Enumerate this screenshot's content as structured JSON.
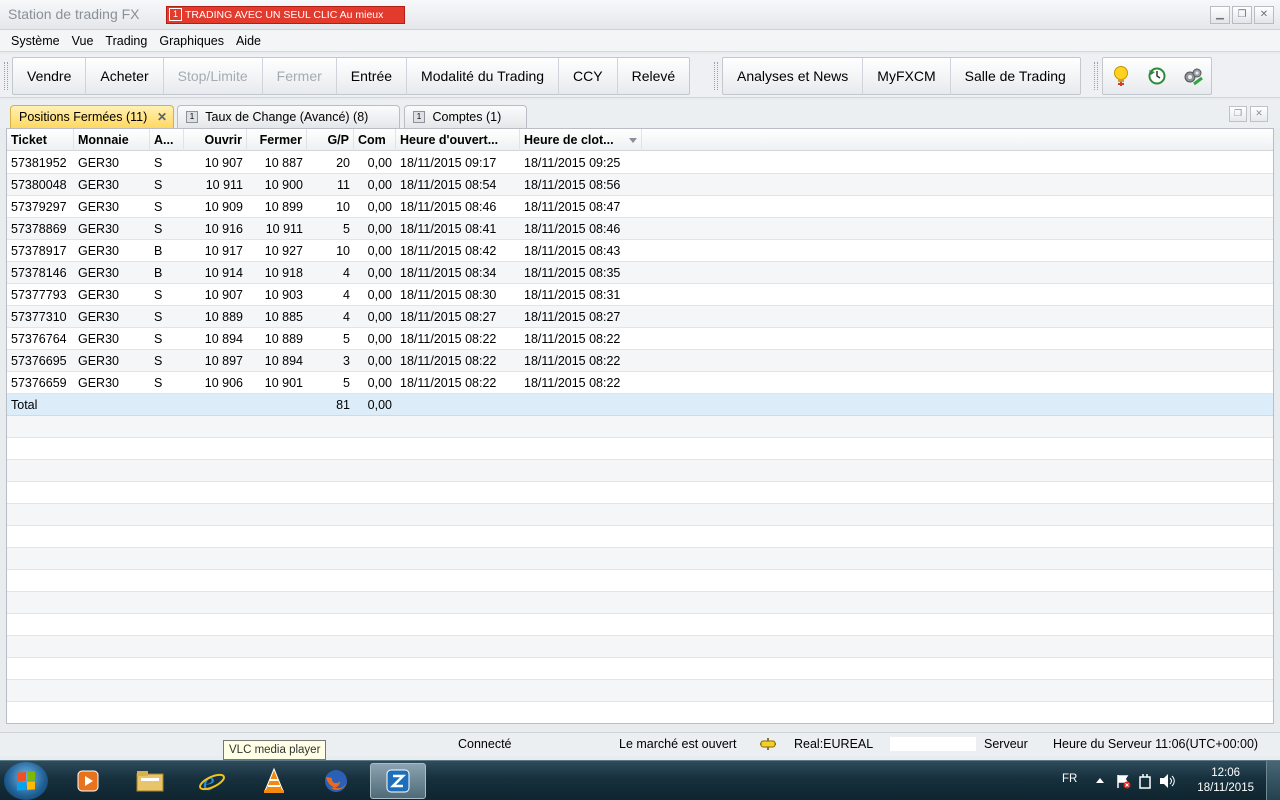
{
  "window": {
    "title": "Station de trading FX",
    "one_click_label": "TRADING AVEC UN SEUL CLIC Au mieux",
    "one_click_icon_text": "1",
    "btn_minimize": "▁",
    "btn_restore": "❐",
    "btn_close": "✕"
  },
  "menu": [
    "Système",
    "Vue",
    "Trading",
    "Graphiques",
    "Aide"
  ],
  "toolbar": {
    "group1": [
      {
        "label": "Vendre",
        "enabled": true
      },
      {
        "label": "Acheter",
        "enabled": true
      },
      {
        "label": "Stop/Limite",
        "enabled": false
      },
      {
        "label": "Fermer",
        "enabled": false
      },
      {
        "label": "Entrée",
        "enabled": true
      },
      {
        "label": "Modalité du Trading",
        "enabled": true
      },
      {
        "label": "CCY",
        "enabled": true
      },
      {
        "label": "Relevé",
        "enabled": true
      }
    ],
    "group2": [
      {
        "label": "Analyses et News"
      },
      {
        "label": "MyFXCM"
      },
      {
        "label": "Salle de Trading"
      }
    ],
    "icons": [
      "alert-bulb-icon",
      "refresh-clock-icon",
      "settings-gears-icon"
    ]
  },
  "tabs": [
    {
      "label": "Positions Fermées (11)",
      "active": true,
      "close": "✕"
    },
    {
      "label": "Taux de Change (Avancé) (8)",
      "active": false,
      "glyph": "1"
    },
    {
      "label": "Comptes (1)",
      "active": false,
      "glyph": "1"
    }
  ],
  "panel_buttons": {
    "restore": "❐",
    "close": "✕"
  },
  "grid": {
    "columns": [
      "Ticket",
      "Monnaie",
      "A...",
      "Ouvrir",
      "Fermer",
      "G/P",
      "Com",
      "Heure d'ouvert...",
      "Heure de clot..."
    ],
    "rows": [
      [
        "57381952",
        "GER30",
        "S",
        "10 907",
        "10 887",
        "20",
        "0,00",
        "18/11/2015 09:17",
        "18/11/2015 09:25"
      ],
      [
        "57380048",
        "GER30",
        "S",
        "10 911",
        "10 900",
        "11",
        "0,00",
        "18/11/2015 08:54",
        "18/11/2015 08:56"
      ],
      [
        "57379297",
        "GER30",
        "S",
        "10 909",
        "10 899",
        "10",
        "0,00",
        "18/11/2015 08:46",
        "18/11/2015 08:47"
      ],
      [
        "57378869",
        "GER30",
        "S",
        "10 916",
        "10 911",
        "5",
        "0,00",
        "18/11/2015 08:41",
        "18/11/2015 08:46"
      ],
      [
        "57378917",
        "GER30",
        "B",
        "10 917",
        "10 927",
        "10",
        "0,00",
        "18/11/2015 08:42",
        "18/11/2015 08:43"
      ],
      [
        "57378146",
        "GER30",
        "B",
        "10 914",
        "10 918",
        "4",
        "0,00",
        "18/11/2015 08:34",
        "18/11/2015 08:35"
      ],
      [
        "57377793",
        "GER30",
        "S",
        "10 907",
        "10 903",
        "4",
        "0,00",
        "18/11/2015 08:30",
        "18/11/2015 08:31"
      ],
      [
        "57377310",
        "GER30",
        "S",
        "10 889",
        "10 885",
        "4",
        "0,00",
        "18/11/2015 08:27",
        "18/11/2015 08:27"
      ],
      [
        "57376764",
        "GER30",
        "S",
        "10 894",
        "10 889",
        "5",
        "0,00",
        "18/11/2015 08:22",
        "18/11/2015 08:22"
      ],
      [
        "57376695",
        "GER30",
        "S",
        "10 897",
        "10 894",
        "3",
        "0,00",
        "18/11/2015 08:22",
        "18/11/2015 08:22"
      ],
      [
        "57376659",
        "GER30",
        "S",
        "10 906",
        "10 901",
        "5",
        "0,00",
        "18/11/2015 08:22",
        "18/11/2015 08:22"
      ]
    ],
    "total": {
      "label": "Total",
      "gp": "81",
      "com": "0,00"
    }
  },
  "statusbar": {
    "connection": "Connecté",
    "market": "Le marché est ouvert",
    "account": "Real:EUREAL",
    "server": "Serveur",
    "server_time": "Heure du Serveur 11:06(UTC+00:00)"
  },
  "tooltip": "VLC media player",
  "taskbar": {
    "apps": [
      "windows-media-player-icon",
      "file-explorer-icon",
      "internet-explorer-icon",
      "vlc-icon",
      "firefox-icon",
      "fxcm-trading-station-icon"
    ],
    "language": "FR",
    "time": "12:06",
    "date": "18/11/2015"
  },
  "colors": {
    "active_tab": "#ffd860",
    "one_click_red": "#e23b2e",
    "total_row": "#dcecf9"
  }
}
